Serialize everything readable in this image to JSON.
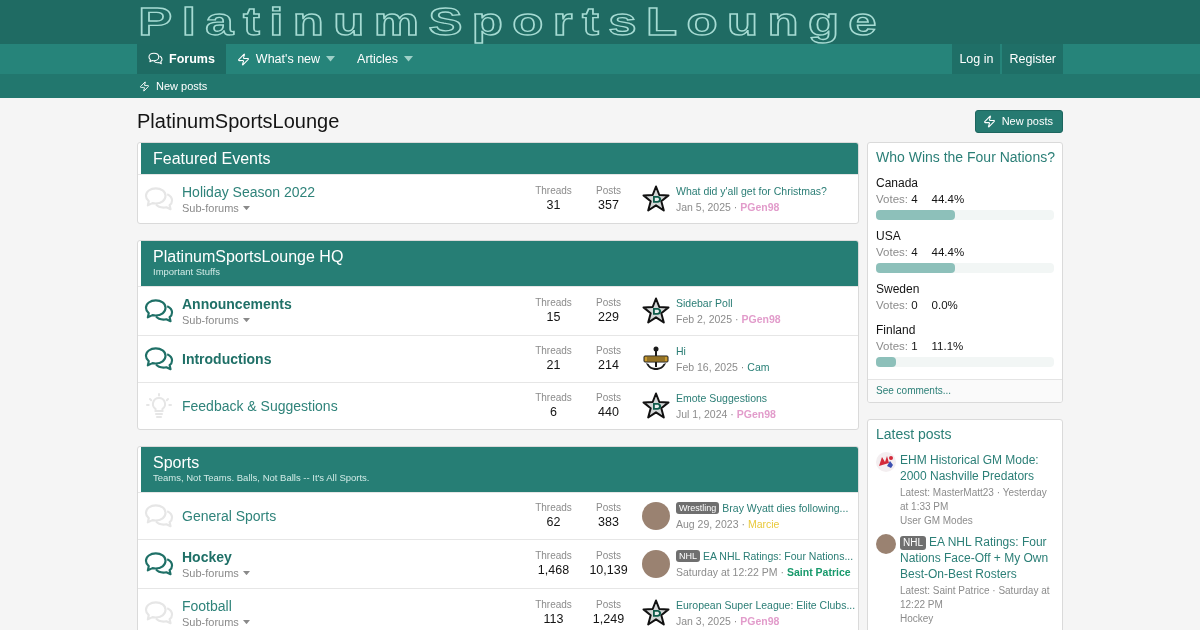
{
  "header": {
    "logo": "PlatinumSportsLounge"
  },
  "nav": {
    "tabs": [
      {
        "label": "Forums",
        "selected": true,
        "dropdown": false
      },
      {
        "label": "What's new",
        "selected": false,
        "dropdown": true
      },
      {
        "label": "Articles",
        "selected": false,
        "dropdown": true
      }
    ],
    "account": [
      {
        "label": "Log in"
      },
      {
        "label": "Register"
      }
    ]
  },
  "sub_nav": [
    {
      "label": "New posts"
    }
  ],
  "page": {
    "title": "PlatinumSportsLounge",
    "action": {
      "label": "New posts"
    }
  },
  "categories": [
    {
      "title": "Featured Events",
      "forums": [
        {
          "title": "Holiday Season 2022",
          "kind": "chat",
          "unread": false,
          "subforums": "Sub-forums",
          "stats": [
            {
              "label": "Threads",
              "value": "31"
            },
            {
              "label": "Posts",
              "value": "357"
            }
          ],
          "latest": {
            "kind": "star",
            "title": "What did y'all get for Christmas?",
            "date": "Jan 5, 2025 ·",
            "user": {
              "name": "PGen98",
              "color": "#e29ccb",
              "bold": true
            }
          }
        }
      ]
    },
    {
      "title": "PlatinumSportsLounge HQ",
      "description": "Important Stuffs",
      "forums": [
        {
          "title": "Announcements",
          "kind": "chat",
          "unread": true,
          "subforums": "Sub-forums",
          "stats": [
            {
              "label": "Threads",
              "value": "15"
            },
            {
              "label": "Posts",
              "value": "229"
            }
          ],
          "latest": {
            "kind": "star",
            "title": "Sidebar Poll",
            "date": "Feb 2, 2025 ·",
            "user": {
              "name": "PGen98",
              "color": "#e29ccb",
              "bold": true
            }
          }
        },
        {
          "title": "Introductions",
          "kind": "chat",
          "unread": true,
          "stats": [
            {
              "label": "Threads",
              "value": "21"
            },
            {
              "label": "Posts",
              "value": "214"
            }
          ],
          "latest": {
            "kind": "badge",
            "title": "Hi",
            "date": "Feb 16, 2025 ·",
            "user": {
              "name": "Cam",
              "color": "#2a8077",
              "bold": false
            }
          }
        },
        {
          "title": "Feedback & Suggestions",
          "kind": "bulb",
          "unread": false,
          "stats": [
            {
              "label": "Threads",
              "value": "6"
            },
            {
              "label": "Posts",
              "value": "440"
            }
          ],
          "latest": {
            "kind": "star",
            "title": "Emote Suggestions",
            "date": "Jul 1, 2024 ·",
            "user": {
              "name": "PGen98",
              "color": "#e29ccb",
              "bold": true
            }
          }
        }
      ]
    },
    {
      "title": "Sports",
      "description": "Teams, Not Teams. Balls, Not Balls -- It's All Sports.",
      "forums": [
        {
          "title": "General Sports",
          "kind": "chat",
          "unread": false,
          "stats": [
            {
              "label": "Threads",
              "value": "62"
            },
            {
              "label": "Posts",
              "value": "383"
            }
          ],
          "latest": {
            "kind": "photo",
            "prefix": "Wrestling",
            "title": "Bray Wyatt dies following...",
            "date": "Aug 29, 2023 ·",
            "user": {
              "name": "Marcie",
              "color": "#e9c93c",
              "bold": false
            }
          }
        },
        {
          "title": "Hockey",
          "kind": "chat",
          "unread": true,
          "subforums": "Sub-forums",
          "stats": [
            {
              "label": "Threads",
              "value": "1,468"
            },
            {
              "label": "Posts",
              "value": "10,139"
            }
          ],
          "latest": {
            "kind": "photo",
            "prefix": "NHL",
            "title": "EA NHL Ratings: Four Nations...",
            "date": "Saturday at 12:22 PM ·",
            "user": {
              "name": "Saint Patrice",
              "color": "#17996b",
              "bold": true
            }
          }
        },
        {
          "title": "Football",
          "kind": "chat",
          "unread": false,
          "subforums": "Sub-forums",
          "stats": [
            {
              "label": "Threads",
              "value": "113"
            },
            {
              "label": "Posts",
              "value": "1,249"
            }
          ],
          "latest": {
            "kind": "star",
            "title": "European Super League: Elite Clubs...",
            "date": "Jan 3, 2025 ·",
            "user": {
              "name": "PGen98",
              "color": "#e29ccb",
              "bold": true
            }
          }
        }
      ]
    }
  ],
  "sidebar": {
    "poll": {
      "title": "Who Wins the Four Nations?",
      "options": [
        {
          "name": "Canada",
          "votes_label": "Votes:",
          "votes": "4",
          "percent": "44.4%",
          "level": 0.444
        },
        {
          "name": "USA",
          "votes_label": "Votes:",
          "votes": "4",
          "percent": "44.4%",
          "level": 0.444
        },
        {
          "name": "Sweden",
          "votes_label": "Votes:",
          "votes": "0",
          "percent": "0.0%"
        },
        {
          "name": "Finland",
          "votes_label": "Votes:",
          "votes": "1",
          "percent": "11.1%",
          "level": 0.111
        }
      ],
      "footer": "See comments..."
    },
    "latest_posts": {
      "title": "Latest posts",
      "items": [
        {
          "kind": "logo",
          "title": "EHM Historical GM Mode: 2000 Nashville Predators",
          "meta": "Latest: MasterMatt23 · Yesterday at 1:33 PM",
          "forum": "User GM Modes"
        },
        {
          "kind": "photo",
          "prefix": "NHL",
          "title": "EA NHL Ratings: Four Nations Face-Off + My Own Best-On-Best Rosters",
          "meta": "Latest: Saint Patrice · Saturday at 12:22 PM",
          "forum": "Hockey"
        }
      ]
    }
  }
}
